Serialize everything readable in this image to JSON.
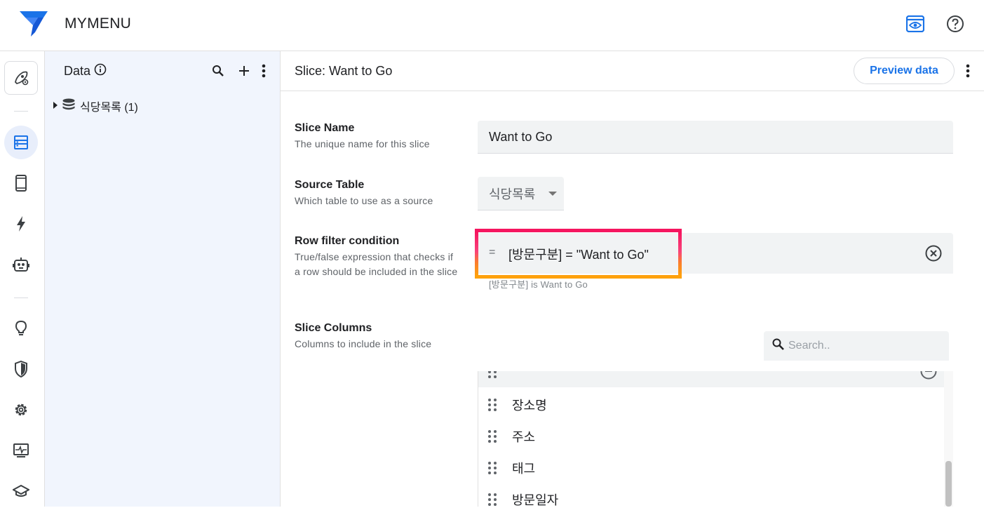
{
  "app": {
    "title": "MYMENU",
    "brand_color": "#1a73e8",
    "top_icons": [
      "preview-eye-icon",
      "help-icon"
    ]
  },
  "left_rail": {
    "items": [
      "rocket-settings-icon",
      "data-icon",
      "mobile-icon",
      "automation-bolt-icon",
      "bot-icon",
      "idea-bulb-icon",
      "security-shield-icon",
      "settings-gear-icon",
      "monitor-icon",
      "learn-cap-icon"
    ],
    "active": "data-icon"
  },
  "data_panel": {
    "title": "Data",
    "tree": [
      {
        "label": "식당목록 (1)",
        "icon": "database-icon",
        "expanded": false
      }
    ]
  },
  "main": {
    "title": "Slice: Want to Go",
    "preview_button": "Preview data",
    "fields": {
      "slice_name": {
        "label": "Slice Name",
        "description": "The unique name for this slice",
        "value": "Want to Go"
      },
      "source_table": {
        "label": "Source Table",
        "description": "Which table to use as a source",
        "value": "식당목록"
      },
      "row_filter": {
        "label": "Row filter condition",
        "description": "True/false expression that checks if a row should be included in the slice",
        "prefix": "=",
        "value": "[방문구분] = \"Want to Go\"",
        "hint": "[방문구분] is Want to Go"
      },
      "slice_columns": {
        "label": "Slice Columns",
        "description": "Columns to include in the slice",
        "search_placeholder": "Search..",
        "columns": [
          "장소명",
          "주소",
          "태그",
          "방문일자"
        ]
      }
    }
  },
  "highlight_color_top": "#f5155f",
  "highlight_color_bottom": "#fea20c"
}
